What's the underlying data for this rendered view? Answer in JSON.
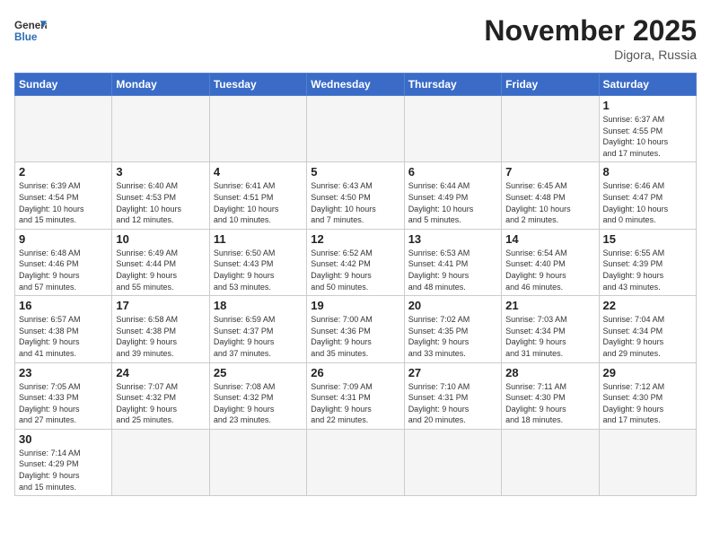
{
  "header": {
    "logo_general": "General",
    "logo_blue": "Blue",
    "month": "November 2025",
    "location": "Digora, Russia"
  },
  "weekdays": [
    "Sunday",
    "Monday",
    "Tuesday",
    "Wednesday",
    "Thursday",
    "Friday",
    "Saturday"
  ],
  "weeks": [
    [
      {
        "day": "",
        "info": ""
      },
      {
        "day": "",
        "info": ""
      },
      {
        "day": "",
        "info": ""
      },
      {
        "day": "",
        "info": ""
      },
      {
        "day": "",
        "info": ""
      },
      {
        "day": "",
        "info": ""
      },
      {
        "day": "1",
        "info": "Sunrise: 6:37 AM\nSunset: 4:55 PM\nDaylight: 10 hours\nand 17 minutes."
      }
    ],
    [
      {
        "day": "2",
        "info": "Sunrise: 6:39 AM\nSunset: 4:54 PM\nDaylight: 10 hours\nand 15 minutes."
      },
      {
        "day": "3",
        "info": "Sunrise: 6:40 AM\nSunset: 4:53 PM\nDaylight: 10 hours\nand 12 minutes."
      },
      {
        "day": "4",
        "info": "Sunrise: 6:41 AM\nSunset: 4:51 PM\nDaylight: 10 hours\nand 10 minutes."
      },
      {
        "day": "5",
        "info": "Sunrise: 6:43 AM\nSunset: 4:50 PM\nDaylight: 10 hours\nand 7 minutes."
      },
      {
        "day": "6",
        "info": "Sunrise: 6:44 AM\nSunset: 4:49 PM\nDaylight: 10 hours\nand 5 minutes."
      },
      {
        "day": "7",
        "info": "Sunrise: 6:45 AM\nSunset: 4:48 PM\nDaylight: 10 hours\nand 2 minutes."
      },
      {
        "day": "8",
        "info": "Sunrise: 6:46 AM\nSunset: 4:47 PM\nDaylight: 10 hours\nand 0 minutes."
      }
    ],
    [
      {
        "day": "9",
        "info": "Sunrise: 6:48 AM\nSunset: 4:46 PM\nDaylight: 9 hours\nand 57 minutes."
      },
      {
        "day": "10",
        "info": "Sunrise: 6:49 AM\nSunset: 4:44 PM\nDaylight: 9 hours\nand 55 minutes."
      },
      {
        "day": "11",
        "info": "Sunrise: 6:50 AM\nSunset: 4:43 PM\nDaylight: 9 hours\nand 53 minutes."
      },
      {
        "day": "12",
        "info": "Sunrise: 6:52 AM\nSunset: 4:42 PM\nDaylight: 9 hours\nand 50 minutes."
      },
      {
        "day": "13",
        "info": "Sunrise: 6:53 AM\nSunset: 4:41 PM\nDaylight: 9 hours\nand 48 minutes."
      },
      {
        "day": "14",
        "info": "Sunrise: 6:54 AM\nSunset: 4:40 PM\nDaylight: 9 hours\nand 46 minutes."
      },
      {
        "day": "15",
        "info": "Sunrise: 6:55 AM\nSunset: 4:39 PM\nDaylight: 9 hours\nand 43 minutes."
      }
    ],
    [
      {
        "day": "16",
        "info": "Sunrise: 6:57 AM\nSunset: 4:38 PM\nDaylight: 9 hours\nand 41 minutes."
      },
      {
        "day": "17",
        "info": "Sunrise: 6:58 AM\nSunset: 4:38 PM\nDaylight: 9 hours\nand 39 minutes."
      },
      {
        "day": "18",
        "info": "Sunrise: 6:59 AM\nSunset: 4:37 PM\nDaylight: 9 hours\nand 37 minutes."
      },
      {
        "day": "19",
        "info": "Sunrise: 7:00 AM\nSunset: 4:36 PM\nDaylight: 9 hours\nand 35 minutes."
      },
      {
        "day": "20",
        "info": "Sunrise: 7:02 AM\nSunset: 4:35 PM\nDaylight: 9 hours\nand 33 minutes."
      },
      {
        "day": "21",
        "info": "Sunrise: 7:03 AM\nSunset: 4:34 PM\nDaylight: 9 hours\nand 31 minutes."
      },
      {
        "day": "22",
        "info": "Sunrise: 7:04 AM\nSunset: 4:34 PM\nDaylight: 9 hours\nand 29 minutes."
      }
    ],
    [
      {
        "day": "23",
        "info": "Sunrise: 7:05 AM\nSunset: 4:33 PM\nDaylight: 9 hours\nand 27 minutes."
      },
      {
        "day": "24",
        "info": "Sunrise: 7:07 AM\nSunset: 4:32 PM\nDaylight: 9 hours\nand 25 minutes."
      },
      {
        "day": "25",
        "info": "Sunrise: 7:08 AM\nSunset: 4:32 PM\nDaylight: 9 hours\nand 23 minutes."
      },
      {
        "day": "26",
        "info": "Sunrise: 7:09 AM\nSunset: 4:31 PM\nDaylight: 9 hours\nand 22 minutes."
      },
      {
        "day": "27",
        "info": "Sunrise: 7:10 AM\nSunset: 4:31 PM\nDaylight: 9 hours\nand 20 minutes."
      },
      {
        "day": "28",
        "info": "Sunrise: 7:11 AM\nSunset: 4:30 PM\nDaylight: 9 hours\nand 18 minutes."
      },
      {
        "day": "29",
        "info": "Sunrise: 7:12 AM\nSunset: 4:30 PM\nDaylight: 9 hours\nand 17 minutes."
      }
    ],
    [
      {
        "day": "30",
        "info": "Sunrise: 7:14 AM\nSunset: 4:29 PM\nDaylight: 9 hours\nand 15 minutes."
      },
      {
        "day": "",
        "info": ""
      },
      {
        "day": "",
        "info": ""
      },
      {
        "day": "",
        "info": ""
      },
      {
        "day": "",
        "info": ""
      },
      {
        "day": "",
        "info": ""
      },
      {
        "day": "",
        "info": ""
      }
    ]
  ]
}
